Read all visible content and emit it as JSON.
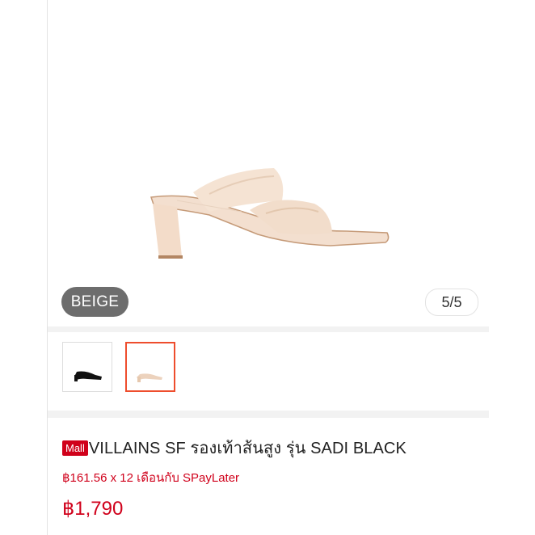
{
  "gallery": {
    "variant_label": "BEIGE",
    "image_counter": "5/5",
    "thumbnails": [
      {
        "name": "black-sandal",
        "selected": false
      },
      {
        "name": "beige-sandal",
        "selected": true
      }
    ]
  },
  "product": {
    "mall_badge": "Mall",
    "title": "VILLAINS SF รองเท้าส้นสูง รุ่น SADI BLACK",
    "installment": "฿161.56 x 12 เดือนกับ SPayLater",
    "price": "฿1,790"
  },
  "colors": {
    "accent": "#d0011b",
    "selected_border": "#ee4d2d",
    "pill_bg": "#6d6d6d"
  }
}
